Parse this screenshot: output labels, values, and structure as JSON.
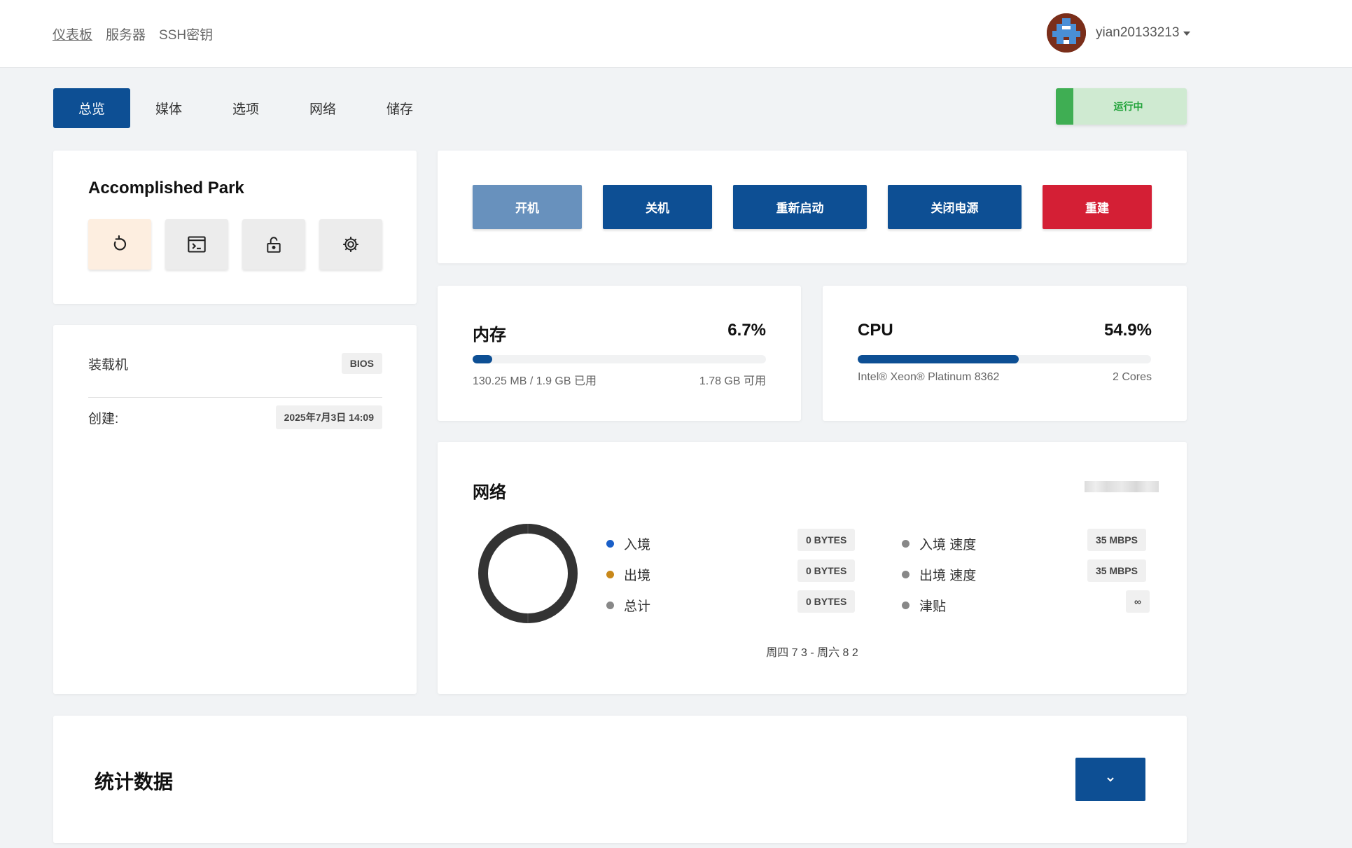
{
  "nav": {
    "links": [
      "仪表板",
      "服务器",
      "SSH密钥"
    ],
    "username": "yian20133213"
  },
  "tabs": [
    "总览",
    "媒体",
    "选项",
    "网络",
    "储存"
  ],
  "status": {
    "label": "运行中",
    "color": "#3fae53"
  },
  "server": {
    "name": "Accomplished Park",
    "quick_actions": [
      "reinstall-icon",
      "terminal-icon",
      "unlock-icon",
      "gear-icon"
    ]
  },
  "info": {
    "loader_label": "装载机",
    "loader_value": "BIOS",
    "created_label": "创建:",
    "created_value": "2025年7月3日 14:09"
  },
  "power": {
    "start": "开机",
    "shutdown": "关机",
    "restart": "重新启动",
    "poweroff": "关闭电源",
    "rebuild": "重建"
  },
  "memory": {
    "title": "内存",
    "percent_label": "6.7%",
    "percent": 6.7,
    "used": "130.25 MB / 1.9 GB 已用",
    "available": "1.78 GB 可用"
  },
  "cpu": {
    "title": "CPU",
    "percent_label": "54.9%",
    "percent": 54.9,
    "model": "Intel® Xeon® Platinum 8362",
    "cores": "2 Cores"
  },
  "network": {
    "title": "网络",
    "left": [
      {
        "label": "入境",
        "value": "0 BYTES",
        "color": "#1a5fc8"
      },
      {
        "label": "出境",
        "value": "0 BYTES",
        "color": "#c8881a"
      },
      {
        "label": "总计",
        "value": "0 BYTES",
        "color": "#888888"
      }
    ],
    "right": [
      {
        "label": "入境 速度",
        "value": "35 MBPS",
        "color": "#888888"
      },
      {
        "label": "出境 速度",
        "value": "35 MBPS",
        "color": "#888888"
      },
      {
        "label": "津贴",
        "value": "∞",
        "color": "#888888"
      }
    ],
    "range": "周四 7 3 - 周六 8 2"
  },
  "stats": {
    "title": "统计数据"
  }
}
